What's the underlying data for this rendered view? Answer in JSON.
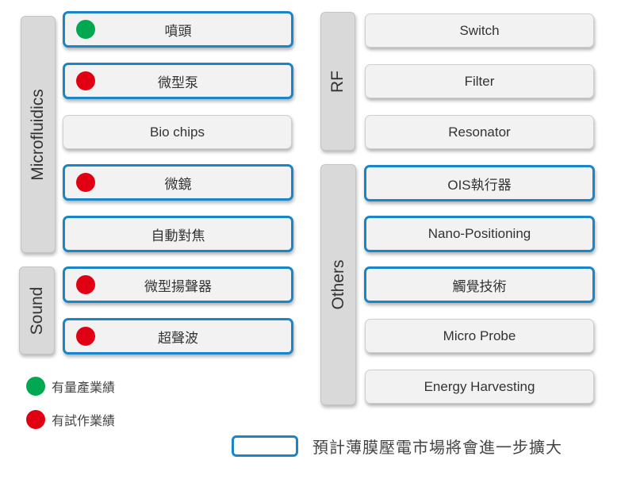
{
  "colors": {
    "mass_production": "#00a84f",
    "trial_production": "#e00012",
    "highlight_border": "#1a86c7",
    "category_bg": "#d9d9d9",
    "item_bg": "#f2f2f2"
  },
  "categories": [
    {
      "label": "Microfluidics",
      "items": [
        {
          "label": "噴頭",
          "status": "mass_production",
          "highlighted": true
        },
        {
          "label": "微型泵",
          "status": "trial_production",
          "highlighted": true
        },
        {
          "label": "Bio chips",
          "status": null,
          "highlighted": false
        },
        {
          "label": "微鏡",
          "status": "trial_production",
          "highlighted": true
        },
        {
          "label": "自動對焦",
          "status": null,
          "highlighted": true
        }
      ]
    },
    {
      "label": "Sound",
      "items": [
        {
          "label": "微型揚聲器",
          "status": "trial_production",
          "highlighted": true
        },
        {
          "label": "超聲波",
          "status": "trial_production",
          "highlighted": true
        }
      ]
    },
    {
      "label": "RF",
      "items": [
        {
          "label": "Switch",
          "status": null,
          "highlighted": false
        },
        {
          "label": "Filter",
          "status": null,
          "highlighted": false
        },
        {
          "label": "Resonator",
          "status": null,
          "highlighted": false
        }
      ]
    },
    {
      "label": "Others",
      "items": [
        {
          "label": "OIS執行器",
          "status": null,
          "highlighted": true
        },
        {
          "label": "Nano-Positioning",
          "status": null,
          "highlighted": true
        },
        {
          "label": "觸覺技術",
          "status": null,
          "highlighted": true
        },
        {
          "label": "Micro Probe",
          "status": null,
          "highlighted": false
        },
        {
          "label": "Energy Harvesting",
          "status": null,
          "highlighted": false
        }
      ]
    }
  ],
  "legend": {
    "mass_production": "有量產業績",
    "trial_production": "有試作業績",
    "highlight_note": "預計薄膜壓電市場將會進一步擴大"
  }
}
